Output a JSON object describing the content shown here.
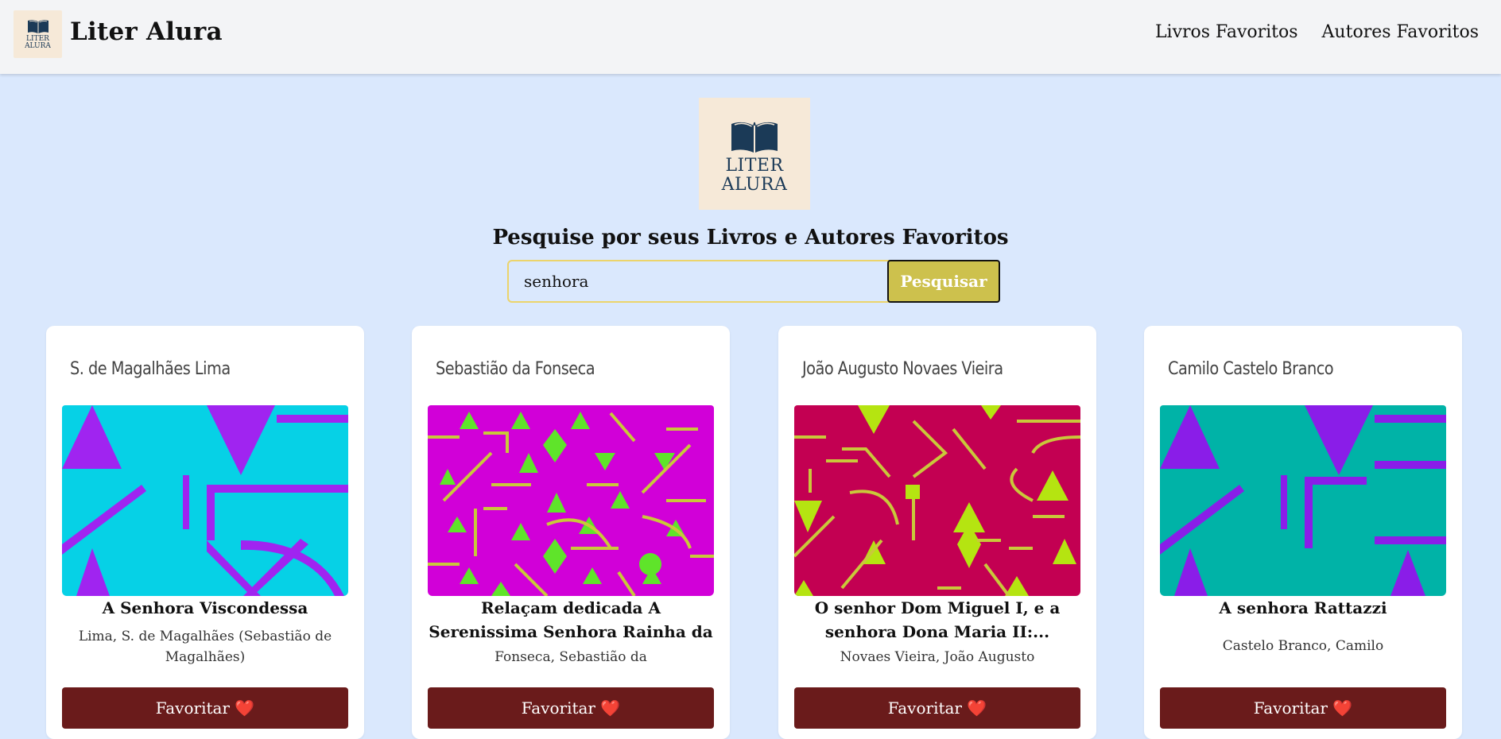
{
  "header": {
    "logo_text_line1": "LITER",
    "logo_text_line2": "ALURA",
    "title": "Liter Alura",
    "nav": [
      {
        "label": "Livros Favoritos"
      },
      {
        "label": "Autores Favoritos"
      }
    ]
  },
  "hero": {
    "logo_text_line1": "LITER",
    "logo_text_line2": "ALURA",
    "heading": "Pesquise por seus Livros e Autores Favoritos"
  },
  "search": {
    "value": "senhora",
    "button_label": "Pesquisar"
  },
  "colors": {
    "accent": "#cdc14d",
    "favorite_button": "#6a1b1b",
    "background": "#dae8fd"
  },
  "books": [
    {
      "cover_author": "S. de Magalhães Lima",
      "title": "A Senhora Viscondessa",
      "author": "Lima, S. de Magalhães (Sebastião de Magalhães)",
      "favorite_label": "Favoritar ❤️"
    },
    {
      "cover_author": "Sebastião da Fonseca",
      "title": "Relaçam dedicada A Serenissima Senhora Rainha da Gram...",
      "author": "Fonseca, Sebastião da",
      "favorite_label": "Favoritar ❤️"
    },
    {
      "cover_author": "João Augusto Novaes Vieira",
      "title": "O senhor Dom Miguel I, e a senhora Dona Maria II:...",
      "author": "Novaes Vieira, João Augusto",
      "favorite_label": "Favoritar ❤️"
    },
    {
      "cover_author": "Camilo Castelo Branco",
      "title": "A senhora Rattazzi",
      "author": "Castelo Branco, Camilo",
      "favorite_label": "Favoritar ❤️"
    }
  ]
}
